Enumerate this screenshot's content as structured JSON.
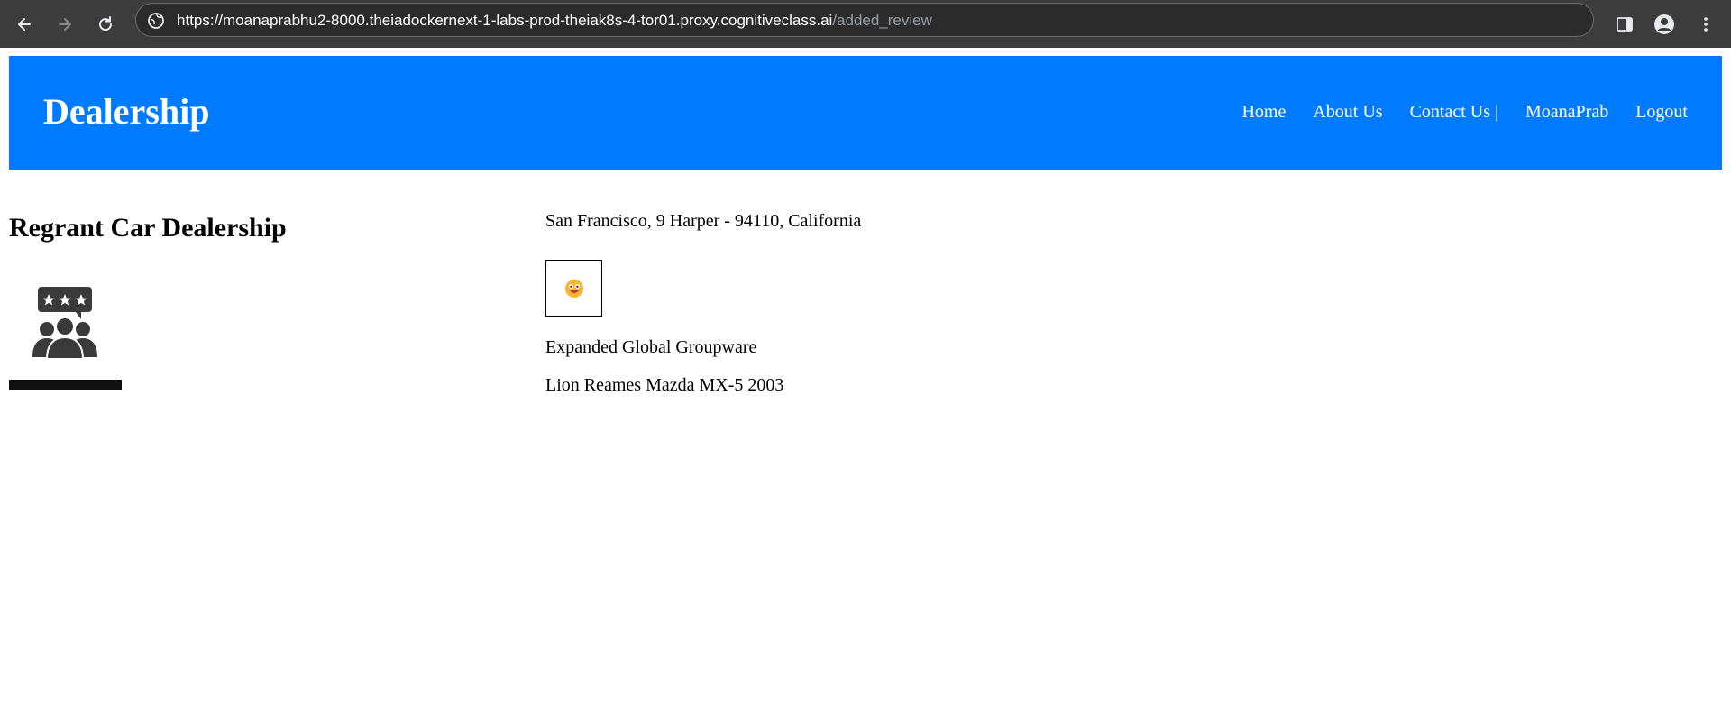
{
  "browser": {
    "url_host": "https://moanaprabhu2-8000.theiadockernext-1-labs-prod-theiak8s-4-tor01.proxy.cognitiveclass.ai",
    "url_path": "/added_review"
  },
  "navbar": {
    "brand": "Dealership",
    "links": [
      "Home",
      "About Us",
      "Contact Us |",
      "MoanaPrab",
      "Logout"
    ]
  },
  "dealer": {
    "name": "Regrant Car Dealership",
    "address": "San Francisco, 9 Harper - 94110, California"
  },
  "review": {
    "sentiment_icon": "positive-emoji-icon",
    "text": "Expanded Global Groupware",
    "car": "Lion Reames Mazda MX-5 2003"
  },
  "colors": {
    "navbar_bg": "#007bff",
    "chrome_bg": "#3c3c3c"
  }
}
